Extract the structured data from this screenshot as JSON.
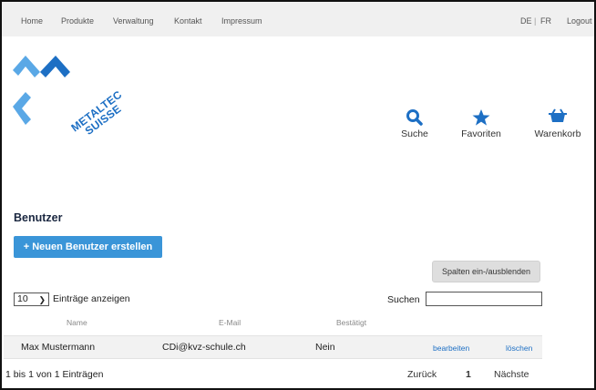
{
  "nav": {
    "links": [
      "Home",
      "Produkte",
      "Verwaltung",
      "Kontakt",
      "Impressum"
    ],
    "lang_de": "DE",
    "lang_sep": "|",
    "lang_fr": "FR",
    "logout": "Logout"
  },
  "logo": {
    "line1": "METALTEC",
    "line2": "SUISSE"
  },
  "header_icons": [
    {
      "label": "Suche",
      "icon": "search-icon"
    },
    {
      "label": "Favoriten",
      "icon": "star-icon"
    },
    {
      "label": "Warenkorb",
      "icon": "basket-icon"
    }
  ],
  "page": {
    "title": "Benutzer",
    "create_button": "+ Neuen Benutzer erstellen",
    "columns_button": "Spalten ein-/ausblenden"
  },
  "table": {
    "length_value": "10",
    "length_label": "Einträge anzeigen",
    "search_label": "Suchen",
    "search_value": "",
    "headers": [
      "Name",
      "E-Mail",
      "Bestätigt"
    ],
    "rows": [
      {
        "name": "Max Mustermann",
        "email": "CDi@kvz-schule.ch",
        "confirmed": "Nein",
        "edit": "bearbeiten",
        "delete": "löschen"
      }
    ],
    "info": "1 bis 1 von 1 Einträgen",
    "prev": "Zurück",
    "page": "1",
    "next": "Nächste"
  },
  "colors": {
    "accent": "#3a95d8",
    "logo_blue": "#1d6fc4",
    "nav_bg": "#f0f0f0"
  }
}
